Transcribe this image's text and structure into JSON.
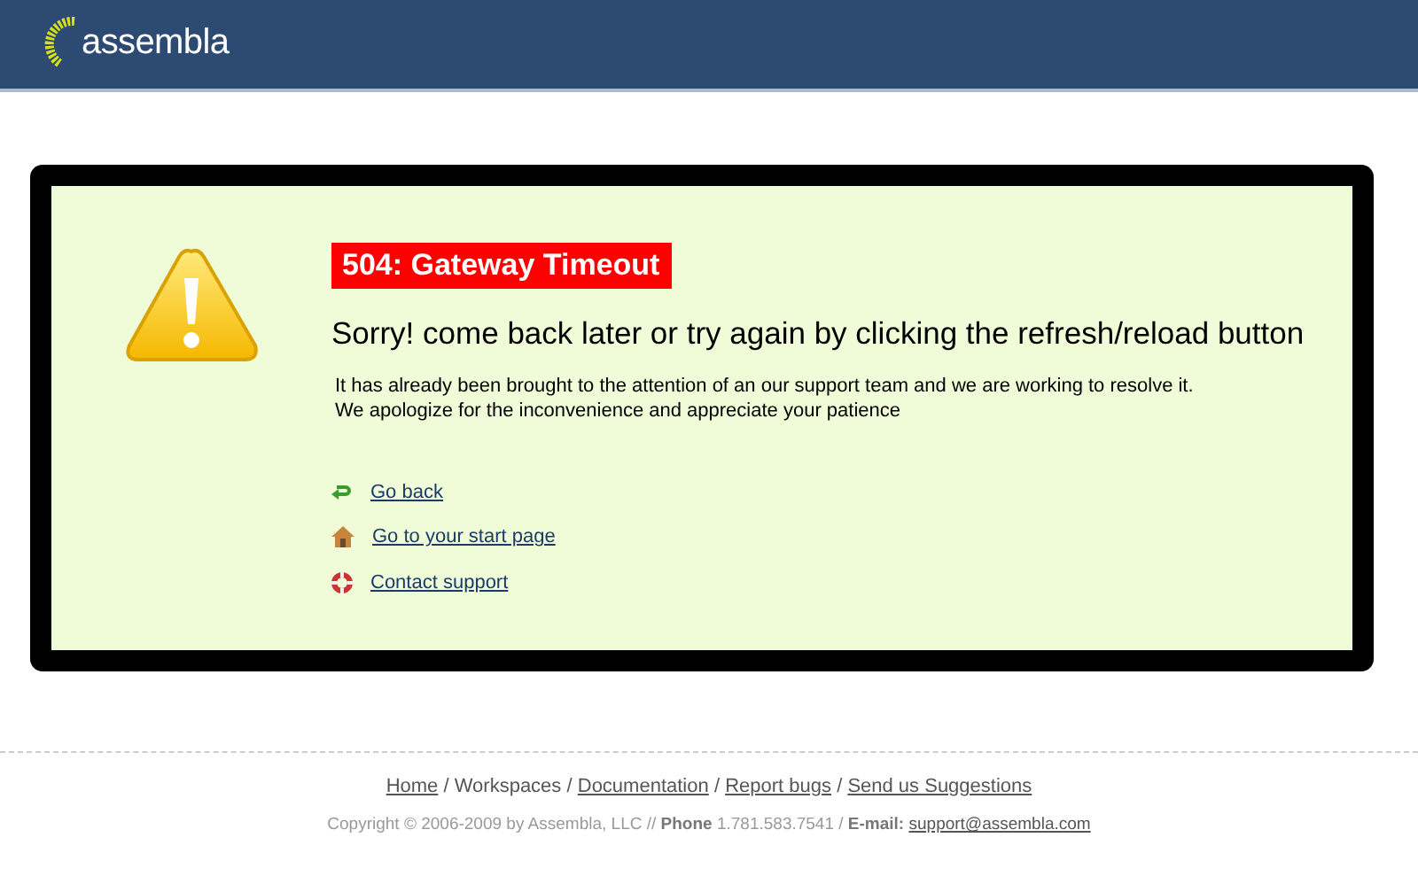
{
  "header": {
    "logo": "assembla"
  },
  "error": {
    "title": "504: Gateway Timeout",
    "headline": "Sorry! come back later or try again by clicking the refresh/reload button",
    "details": [
      "It has already been brought to the attention of an our support team and we are working to resolve it.",
      "We apologize for the inconvenience and appreciate your patience"
    ]
  },
  "links": [
    {
      "kind": "back",
      "label": "Go back"
    },
    {
      "kind": "home",
      "label": "Go to your start page"
    },
    {
      "kind": "support",
      "label": "Contact support"
    }
  ],
  "footer": {
    "nav": [
      {
        "kind": "link",
        "text": "Home"
      },
      {
        "kind": "separator",
        "text": "/"
      },
      {
        "kind": "text",
        "text": "Workspaces"
      },
      {
        "kind": "separator",
        "text": "/"
      },
      {
        "kind": "link",
        "text": "Documentation"
      },
      {
        "kind": "separator",
        "text": "/"
      },
      {
        "kind": "link",
        "text": "Report bugs"
      },
      {
        "kind": "separator",
        "text": "/"
      },
      {
        "kind": "link",
        "text": "Send us Suggestions"
      }
    ],
    "copyright": "Copyright © 2006-2009 by Assembla, LLC // **Phone** 1.781.583.7541 / **E-mail:**",
    "email": "support@assembla.com"
  }
}
